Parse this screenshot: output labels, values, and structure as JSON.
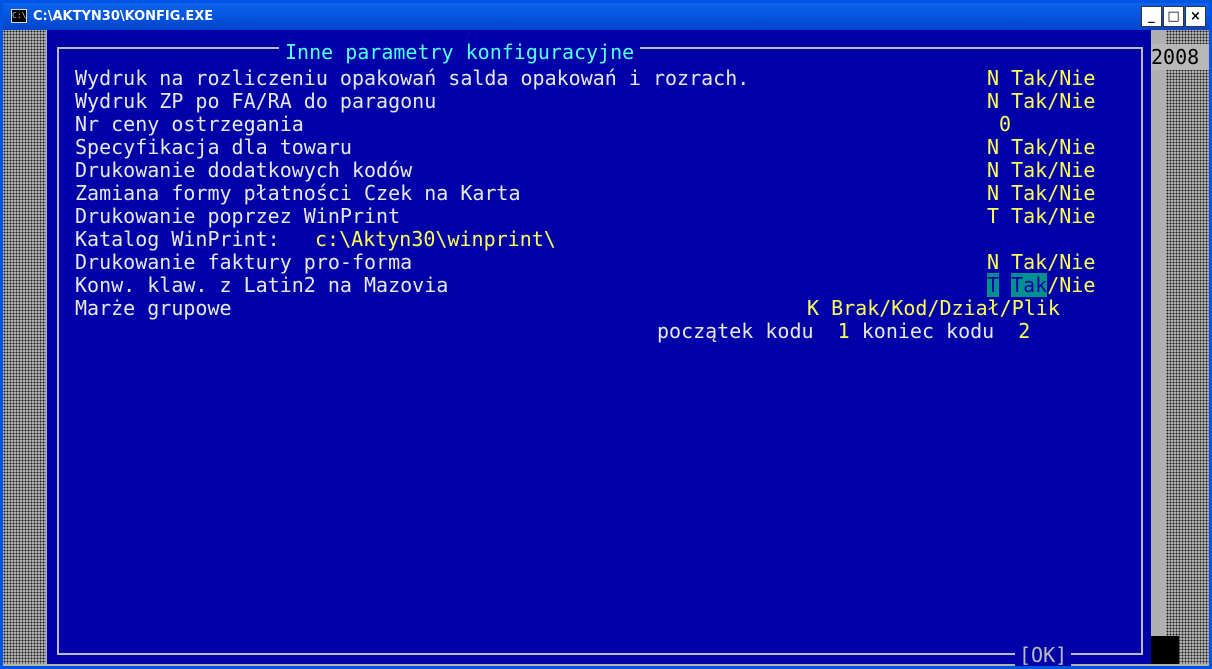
{
  "window": {
    "title": "C:\\AKTYN30\\KONFIG.EXE",
    "icon_text": "C:\\",
    "minimize": "_",
    "maximize": "□",
    "close": "×"
  },
  "console": {
    "frame_title": "Inne parametry konfiguracyjne",
    "year": "2008",
    "ok": "[OK]",
    "rows": [
      {
        "label": "Wydruk na rozliczeniu opakowań salda opakowań i rozrach.",
        "value": "N",
        "options": "Tak/Nie"
      },
      {
        "label": "Wydruk ZP po FA/RA do paragonu",
        "value": "N",
        "options": "Tak/Nie"
      },
      {
        "label": "Nr ceny ostrzegania",
        "value": "0"
      },
      {
        "label": "Specyfikacja dla towaru",
        "value": "N",
        "options": "Tak/Nie"
      },
      {
        "label": "Drukowanie dodatkowych kodów",
        "value": "N",
        "options": "Tak/Nie"
      },
      {
        "label": "Zamiana formy płatności Czek na Karta",
        "value": "N",
        "options": "Tak/Nie"
      },
      {
        "label": "Drukowanie poprzez WinPrint",
        "value": "T",
        "options": "Tak/Nie"
      },
      {
        "label": "Katalog WinPrint:",
        "value": "c:\\Aktyn30\\winprint\\"
      },
      {
        "label": "Drukowanie faktury pro-forma",
        "value": "N",
        "options": "Tak/Nie"
      },
      {
        "label": "Konw. klaw. z Latin2 na Mazovia",
        "value": "T",
        "option_selected": "Tak",
        "option_rest": "/Nie"
      },
      {
        "label": "Marże grupowe",
        "value": "K",
        "options": "Brak/Kod/Dział/Plik"
      }
    ],
    "code_range": {
      "start_label": "początek kodu",
      "start_value": "1",
      "end_label": "koniec kodu",
      "end_value": "2"
    }
  }
}
